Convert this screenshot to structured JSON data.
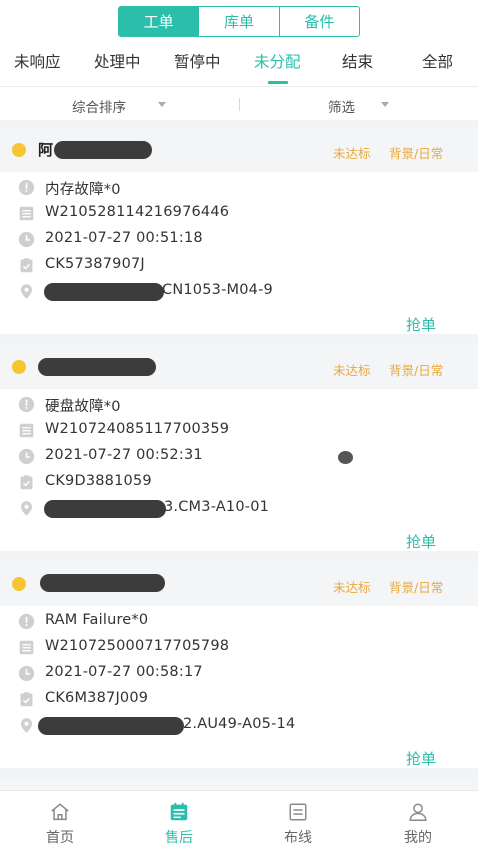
{
  "segment_tabs": [
    {
      "label": "工单",
      "active": true
    },
    {
      "label": "库单",
      "active": false
    },
    {
      "label": "备件",
      "active": false
    }
  ],
  "status_tabs": [
    {
      "label": "未响应"
    },
    {
      "label": "处理中"
    },
    {
      "label": "暂停中"
    },
    {
      "label": "未分配",
      "active": true
    },
    {
      "label": "结束"
    },
    {
      "label": "全部"
    }
  ],
  "filters": {
    "sort_label": "综合排序",
    "filter_label": "筛选"
  },
  "colors": {
    "accent": "#2bbfab",
    "tag": "#e9a93a",
    "dot": "#f7c531"
  },
  "cards": [
    {
      "name": "阿",
      "tags": [
        "未达标",
        "背景/日常"
      ],
      "fault": "内存故障*0",
      "order_no": "W210528114216976446",
      "time": "2021-07-27 00:51:18",
      "ck": "CK57387907J",
      "location": "CN1053-M04-9",
      "action": "抢单"
    },
    {
      "name": "",
      "tags": [
        "未达标",
        "背景/日常"
      ],
      "fault": "硬盘故障*0",
      "order_no": "W210724085117700359",
      "time": "2021-07-27 00:52:31",
      "ck": "CK9D3881059",
      "location": "3.CM3-A10-01",
      "action": "抢单"
    },
    {
      "name": "",
      "tags": [
        "未达标",
        "背景/日常"
      ],
      "fault": "RAM Failure*0",
      "order_no": "W210725000717705798",
      "time": "2021-07-27 00:58:17",
      "ck": "CK6M387J009",
      "location": "2.AU49-A05-14",
      "action": "抢单"
    }
  ],
  "bottom_nav": [
    {
      "label": "首页",
      "icon": "home-icon"
    },
    {
      "label": "售后",
      "icon": "calendar-icon",
      "active": true
    },
    {
      "label": "布线",
      "icon": "list-icon"
    },
    {
      "label": "我的",
      "icon": "user-icon"
    }
  ]
}
